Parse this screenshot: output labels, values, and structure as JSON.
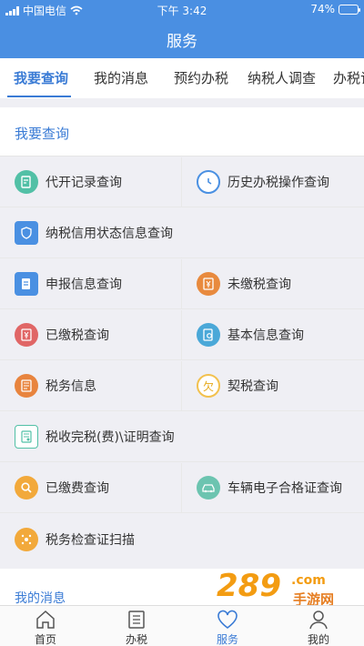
{
  "status": {
    "carrier": "中国电信",
    "time": "下午 3:42",
    "battery": "74%",
    "battery_level": 0.74
  },
  "header": {
    "title": "服务"
  },
  "tabs": [
    {
      "label": "我要查询",
      "active": true
    },
    {
      "label": "我的消息"
    },
    {
      "label": "预约办税"
    },
    {
      "label": "纳税人调查"
    },
    {
      "label": "办税记"
    }
  ],
  "section": {
    "title": "我要查询"
  },
  "items": [
    {
      "label": "代开记录查询",
      "icon": "document-edit-icon",
      "color": "#52c0a6"
    },
    {
      "label": "历史办税操作查询",
      "icon": "clock-tax-icon",
      "color": "#4a90e2"
    },
    {
      "label": "纳税信用状态信息查询",
      "icon": "shield-search-icon",
      "color": "#4a90e2"
    },
    {
      "label": "申报信息查询",
      "icon": "document-upload-icon",
      "color": "#4a90e2"
    },
    {
      "label": "未缴税查询",
      "icon": "yuan-clipboard-icon",
      "color": "#e88a3e"
    },
    {
      "label": "已缴税查询",
      "icon": "yuan-clipboard-icon",
      "color": "#e06666"
    },
    {
      "label": "基本信息查询",
      "icon": "document-search-icon",
      "color": "#4aa8d8"
    },
    {
      "label": "税务信息",
      "icon": "list-document-icon",
      "color": "#e8843e"
    },
    {
      "label": "契税查询",
      "icon": "qian-badge-icon",
      "color": "#f2c14e",
      "badge": "欠"
    },
    {
      "label": "税收完税(费)\\证明查询",
      "icon": "certificate-icon",
      "color": "#52c0a6"
    },
    {
      "label": "已缴费查询",
      "icon": "magnifier-icon",
      "color": "#f2a93b"
    },
    {
      "label": "车辆电子合格证查询",
      "icon": "car-icon",
      "color": "#6cc4b0"
    },
    {
      "label": "税务检查证扫描",
      "icon": "scan-icon",
      "color": "#f2a93b"
    }
  ],
  "messages": {
    "title": "我的消息"
  },
  "watermark": {
    "number": "289",
    "com": ".com",
    "text": "手游网"
  },
  "bottom_nav": [
    {
      "label": "首页",
      "icon": "home-icon"
    },
    {
      "label": "办税",
      "icon": "list-icon"
    },
    {
      "label": "服务",
      "icon": "heart-icon",
      "active": true
    },
    {
      "label": "我的",
      "icon": "person-icon"
    }
  ]
}
